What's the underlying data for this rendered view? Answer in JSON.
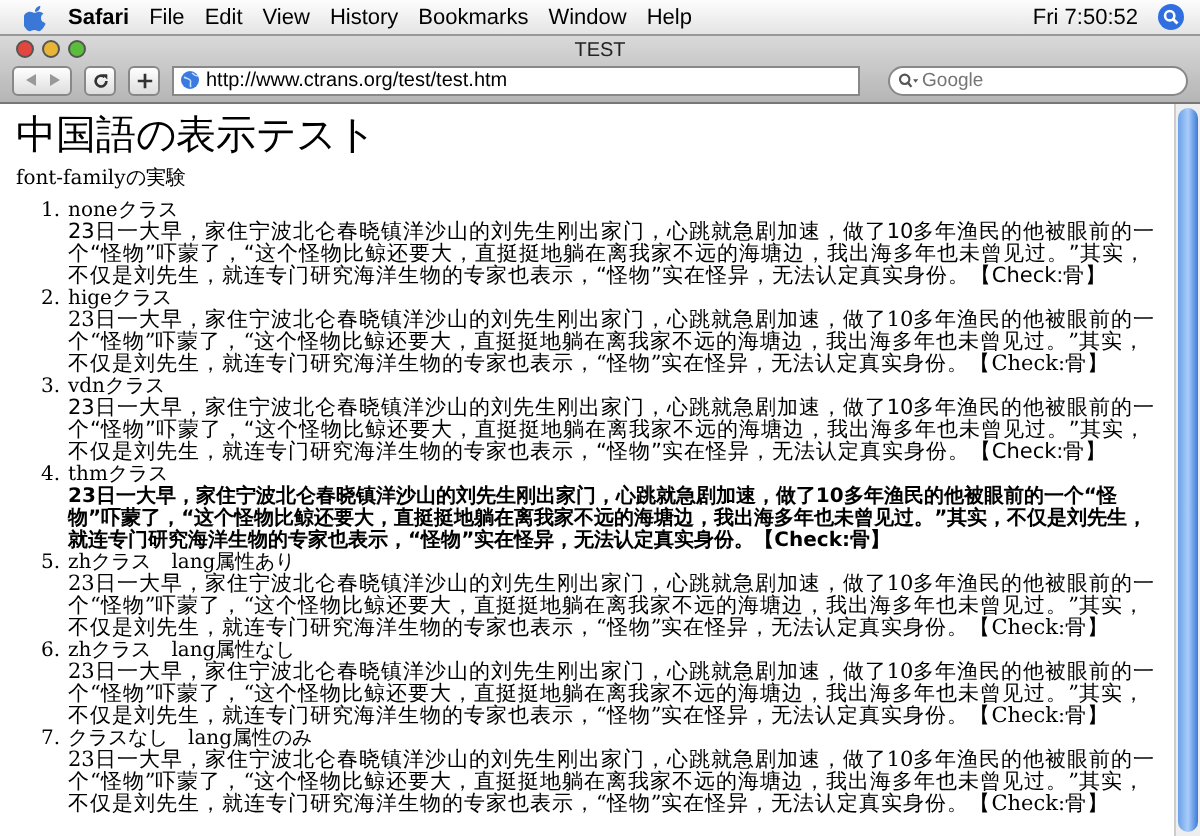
{
  "menubar": {
    "app": "Safari",
    "menus": [
      "File",
      "Edit",
      "View",
      "History",
      "Bookmarks",
      "Window",
      "Help"
    ],
    "clock": "Fri 7:50:52"
  },
  "window": {
    "title": "TEST"
  },
  "toolbar": {
    "url": "http://www.ctrans.org/test/test.htm",
    "search": {
      "placeholder": "Google"
    }
  },
  "page": {
    "heading": "中国語の表示テスト",
    "subheading": "font-familyの実験",
    "items": [
      {
        "number": "1.",
        "title": "noneクラス",
        "kind": "sans",
        "text": "23日一大早，家住宁波北仑春晓镇洋沙山的刘先生刚出家门，心跳就急剧加速，做了10多年渔民的他被眼前的一个“怪物”吓蒙了，“这个怪物比鲸还要大，直挺挺地躺在离我家不远的海塘边，我出海多年也未曾见过。”其实，不仅是刘先生，就连专门研究海洋生物的专家也表示，“怪物”实在怪异，无法认定真实身份。【Check:骨】"
      },
      {
        "number": "2.",
        "title": "higeクラス",
        "kind": "serif",
        "text": "23日一大早，家住宁波北仑春晓镇洋沙山的刘先生刚出家门，心跳就急剧加速，做了10多年渔民的他被眼前的一个“怪物”吓蒙了，“这个怪物比鲸还要大，直挺挺地躺在离我家不远的海塘边，我出海多年也未曾见过。”其实，不仅是刘先生，就连专门研究海洋生物的专家也表示，“怪物”实在怪异，无法认定真实身份。【Check:骨】"
      },
      {
        "number": "3.",
        "title": "vdnクラス",
        "kind": "sans",
        "text": "23日一大早，家住宁波北仑春晓镇洋沙山的刘先生刚出家门，心跳就急剧加速，做了10多年渔民的他被眼前的一个“怪物”吓蒙了，“这个怪物比鲸还要大，直挺挺地躺在离我家不远的海塘边，我出海多年也未曾见过。”其实，不仅是刘先生，就连专门研究海洋生物的专家也表示，“怪物”实在怪异，无法认定真实身份。【Check:骨】"
      },
      {
        "number": "4.",
        "title": "thmクラス",
        "kind": "heavy",
        "text": "23日一大早，家住宁波北仑春晓镇洋沙山的刘先生刚出家门，心跳就急剧加速，做了10多年渔民的他被眼前的一个“怪物”吓蒙了，“这个怪物比鲸还要大，直挺挺地躺在离我家不远的海塘边，我出海多年也未曾见过。”其实，不仅是刘先生，就连专门研究海洋生物的专家也表示，“怪物”实在怪异，无法认定真实身份。【Check:骨】"
      },
      {
        "number": "5.",
        "title": "zhクラス　lang属性あり",
        "kind": "serif",
        "text": "23日一大早，家住宁波北仑春晓镇洋沙山的刘先生刚出家门，心跳就急剧加速，做了10多年渔民的他被眼前的一个“怪物”吓蒙了，“这个怪物比鲸还要大，直挺挺地躺在离我家不远的海塘边，我出海多年也未曾见过。”其实，不仅是刘先生，就连专门研究海洋生物的专家也表示，“怪物”实在怪异，无法认定真实身份。【Check:骨】"
      },
      {
        "number": "6.",
        "title": "zhクラス　lang属性なし",
        "kind": "serif",
        "text": "23日一大早，家住宁波北仑春晓镇洋沙山的刘先生刚出家门，心跳就急剧加速，做了10多年渔民的他被眼前的一个“怪物”吓蒙了，“这个怪物比鲸还要大，直挺挺地躺在离我家不远的海塘边，我出海多年也未曾见过。”其实，不仅是刘先生，就连专门研究海洋生物的专家也表示，“怪物”实在怪异，无法认定真实身份。【Check:骨】"
      },
      {
        "number": "7.",
        "title": "クラスなし　lang属性のみ",
        "kind": "serif",
        "text": "23日一大早，家住宁波北仑春晓镇洋沙山的刘先生刚出家门，心跳就急剧加速，做了10多年渔民的他被眼前的一个“怪物”吓蒙了，“这个怪物比鲸还要大，直挺挺地躺在离我家不远的海塘边，我出海多年也未曾见过。”其实，不仅是刘先生，就连专门研究海洋生物的专家也表示，“怪物”实在怪异，无法认定真实身份。【Check:骨】"
      }
    ]
  }
}
